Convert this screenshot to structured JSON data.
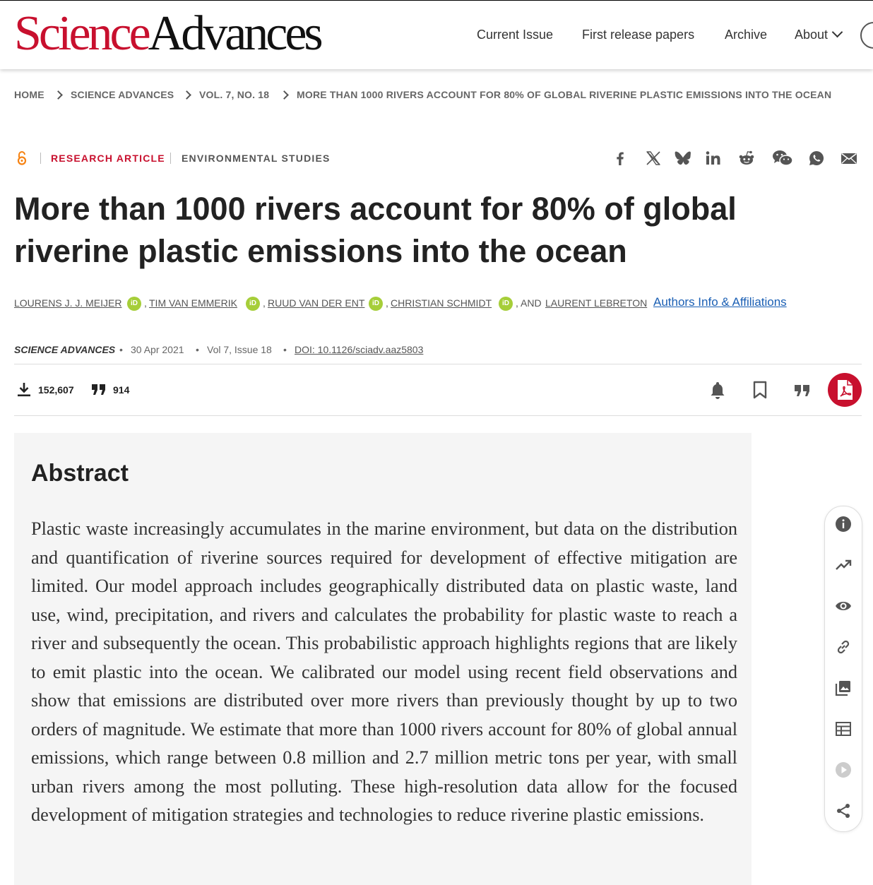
{
  "header": {
    "logo_science": "Science",
    "logo_advances": "Advances",
    "nav": {
      "current_issue": "Current Issue",
      "first_release": "First release papers",
      "archive": "Archive",
      "about": "About"
    }
  },
  "breadcrumb": {
    "home": "HOME",
    "journal": "SCIENCE ADVANCES",
    "issue": "VOL. 7, NO. 18",
    "current": "MORE THAN 1000 RIVERS ACCOUNT FOR 80% OF GLOBAL RIVERINE PLASTIC EMISSIONS INTO THE OCEAN"
  },
  "article": {
    "type": "RESEARCH ARTICLE",
    "subject": "ENVIRONMENTAL STUDIES",
    "title": "More than 1000 rivers account for 80% of global riverine plastic emissions into the ocean",
    "authors": [
      "LOURENS J. J. MEIJER",
      "TIM VAN EMMERIK",
      "RUUD VAN DER ENT",
      "CHRISTIAN SCHMIDT",
      "LAURENT LEBRETON"
    ],
    "author_sep": ",",
    "author_and": ", AND",
    "orcid_label": "iD",
    "affiliations_link": "Authors Info & Affiliations",
    "journal": "SCIENCE ADVANCES",
    "date": "30 Apr 2021",
    "volume": "Vol 7, Issue 18",
    "doi": "DOI: 10.1126/sciadv.aaz5803",
    "downloads": "152,607",
    "citations": "914",
    "dot": "•"
  },
  "share_icons": [
    "facebook-icon",
    "x-twitter-icon",
    "bluesky-icon",
    "linkedin-icon",
    "reddit-icon",
    "wechat-icon",
    "whatsapp-icon",
    "email-icon"
  ],
  "abstract": {
    "heading": "Abstract",
    "text": "Plastic waste increasingly accumulates in the marine environment, but data on the distribution and quantification of riverine sources required for development of effective mitigation are limited. Our model approach includes geographically distributed data on plastic waste, land use, wind, precipitation, and rivers and calculates the probability for plastic waste to reach a river and subsequently the ocean. This probabilistic approach highlights regions that are likely to emit plastic into the ocean. We calibrated our model using recent field observations and show that emissions are distributed over more rivers than previously thought by up to two orders of magnitude. We estimate that more than 1000 rivers account for 80% of global annual emissions, which range between 0.8 million and 2.7 million metric tons per year, with small urban rivers among the most polluting. These high-resolution data allow for the focused development of mitigation strategies and technologies to reduce riverine plastic emissions."
  },
  "side_toolbar": [
    "info-icon",
    "trending-icon",
    "eye-icon",
    "link-icon",
    "image-icon",
    "table-icon",
    "play-icon",
    "share-icon"
  ],
  "colors": {
    "brand_red": "#c8102e",
    "orcid_green": "#a6ce39",
    "link_blue": "#1a5fb4"
  }
}
